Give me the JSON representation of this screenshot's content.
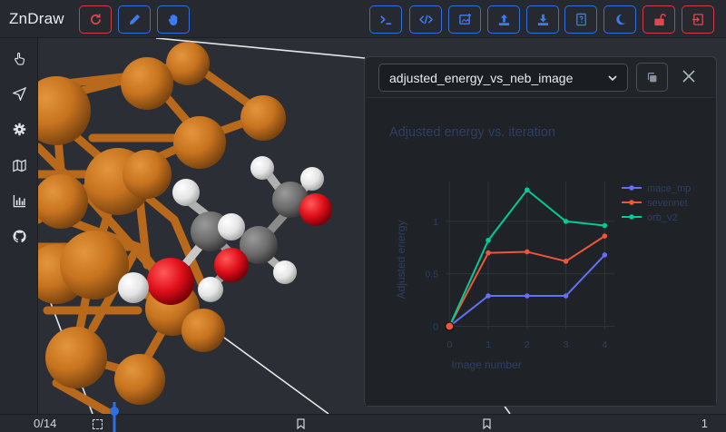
{
  "app": {
    "title": "ZnDraw"
  },
  "toolbar": {
    "left_buttons": [
      "reset-icon",
      "pencil-icon",
      "hand-drawing-icon"
    ],
    "right_buttons": [
      "terminal-icon",
      "code-icon",
      "add-image-icon",
      "upload-icon",
      "download-icon",
      "help-book-icon",
      "moon-icon",
      "unlock-icon",
      "logout-icon"
    ]
  },
  "sidebar": {
    "items": [
      "pointer-hand-icon",
      "send-icon",
      "gear-icon",
      "map-icon",
      "bar-chart-icon",
      "github-icon"
    ]
  },
  "plot_panel": {
    "selected_figure": "adjusted_energy_vs_neb_image"
  },
  "chart_data": {
    "type": "line",
    "title": "Adjusted energy vs. iteration",
    "xlabel": "Image number",
    "ylabel": "Adjusted energy",
    "x": [
      0,
      1,
      2,
      3,
      4
    ],
    "x_ticks": [
      "0",
      "1",
      "2",
      "3",
      "4"
    ],
    "y_ticks": [
      "0",
      "0.5",
      "1"
    ],
    "xlim": [
      -0.1,
      4.25
    ],
    "ylim": [
      -0.03,
      1.38
    ],
    "grid": true,
    "legend_position": "top-right",
    "highlight_point": {
      "x": 0,
      "y": 0
    },
    "series": [
      {
        "name": "mace_mp",
        "color": "#636efa",
        "values": [
          0,
          0.29,
          0.29,
          0.29,
          0.68
        ]
      },
      {
        "name": "sevennet",
        "color": "#ef553b",
        "values": [
          0,
          0.7,
          0.71,
          0.62,
          0.86
        ]
      },
      {
        "name": "orb_v2",
        "color": "#00cc96",
        "values": [
          0,
          0.82,
          1.3,
          1.0,
          0.96
        ]
      }
    ]
  },
  "timeline": {
    "current_frame": "0/14",
    "right_value": "1"
  },
  "colors": {
    "accent": "#2f6fe0",
    "danger": "#d33a44",
    "atom_cu": "#c7731f",
    "atom_o": "#e0101a",
    "atom_c": "#6b6b6b",
    "atom_h": "#e4e4e4"
  }
}
